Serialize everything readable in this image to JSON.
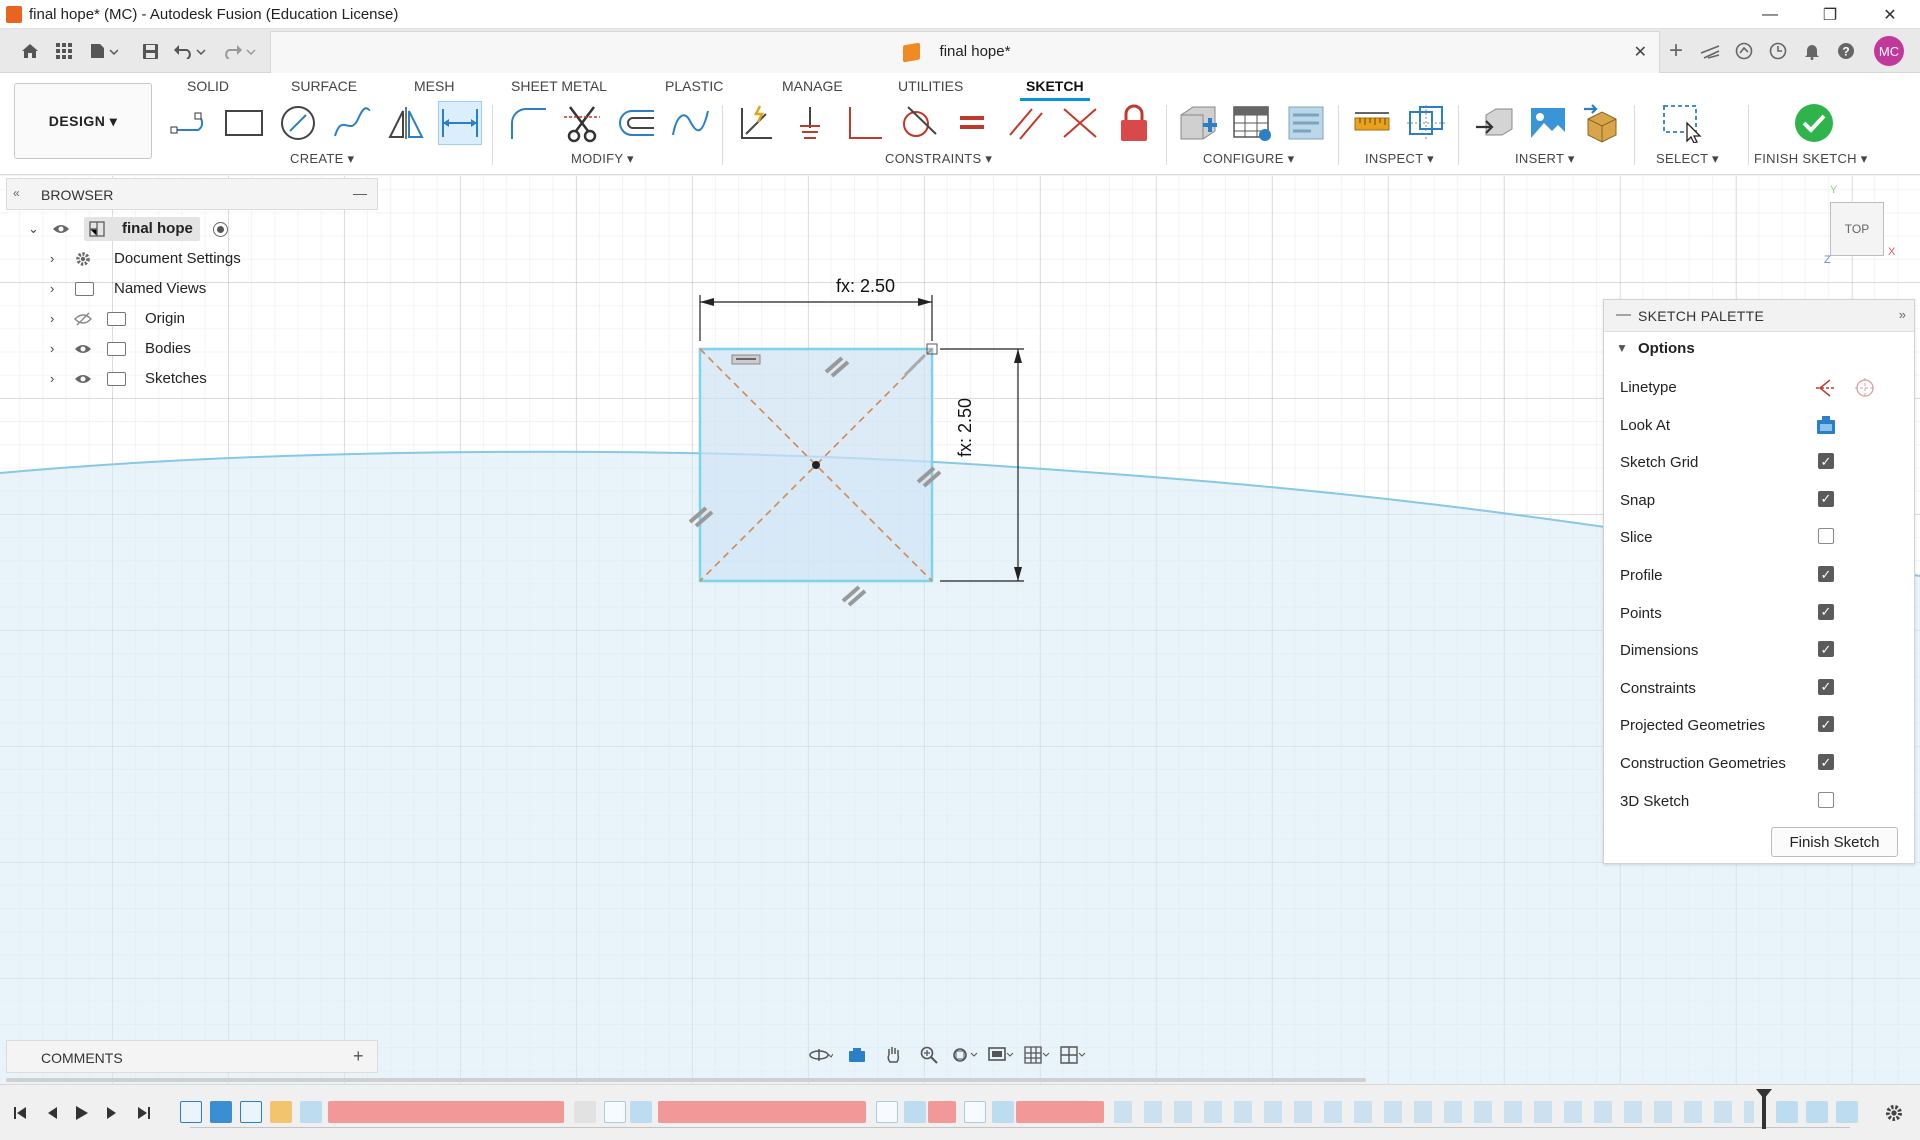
{
  "window": {
    "title": "final hope* (MC) - Autodesk Fusion (Education License)",
    "minimize_glyph": "—",
    "restore_glyph": "❐",
    "close_glyph": "✕"
  },
  "tabbar": {
    "doc_tab_title": "final hope*",
    "close_glyph": "✕",
    "new_tab_glyph": "+",
    "avatar_initials": "MC"
  },
  "ribbon": {
    "workspace": "DESIGN ▾",
    "tabs": [
      "SOLID",
      "SURFACE",
      "MESH",
      "SHEET METAL",
      "PLASTIC",
      "MANAGE",
      "UTILITIES",
      "SKETCH"
    ],
    "active_tab": "SKETCH",
    "groups": [
      "CREATE ▾",
      "MODIFY ▾",
      "CONSTRAINTS ▾",
      "CONFIGURE ▾",
      "INSPECT ▾",
      "INSERT ▾",
      "SELECT ▾",
      "FINISH SKETCH ▾"
    ]
  },
  "browser": {
    "title": "BROWSER",
    "collapse_glyph": "—",
    "root": "final hope",
    "items": [
      "Document Settings",
      "Named Views",
      "Origin",
      "Bodies",
      "Sketches"
    ]
  },
  "sketch": {
    "dim_horizontal": "fx: 2.50",
    "dim_vertical": "fx: 2.50"
  },
  "viewcube": {
    "face": "TOP",
    "axis_x": "X",
    "axis_y": "Y",
    "axis_z": "Z"
  },
  "palette": {
    "title": "SKETCH PALETTE",
    "section": "Options",
    "rows": [
      {
        "label": "Linetype"
      },
      {
        "label": "Look At"
      },
      {
        "label": "Sketch Grid",
        "checked": true
      },
      {
        "label": "Snap",
        "checked": true
      },
      {
        "label": "Slice",
        "checked": false
      },
      {
        "label": "Profile",
        "checked": true
      },
      {
        "label": "Points",
        "checked": true
      },
      {
        "label": "Dimensions",
        "checked": true
      },
      {
        "label": "Constraints",
        "checked": true
      },
      {
        "label": "Projected Geometries",
        "checked": true
      },
      {
        "label": "Construction Geometries",
        "checked": true
      },
      {
        "label": "3D Sketch",
        "checked": false
      }
    ],
    "finish_button": "Finish Sketch",
    "check_glyph": "✓"
  },
  "comments": {
    "title": "COMMENTS",
    "add_glyph": "+"
  },
  "colors": {
    "accent": "#0696d7",
    "sketch_line": "#7fd3e8",
    "profile_fill": "#dcecf8",
    "construction": "#d08a52",
    "timeline_feature": "#f08a8a",
    "finish_green": "#2fb44c"
  }
}
